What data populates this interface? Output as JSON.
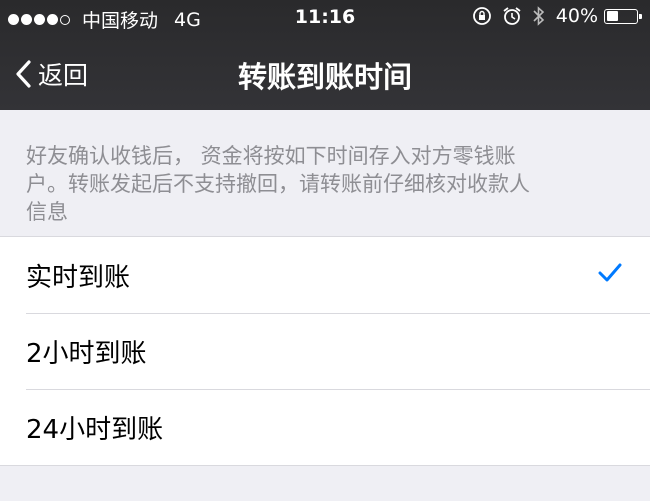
{
  "status_bar": {
    "carrier": "中国移动",
    "network": "4G",
    "time": "11:16",
    "battery": "40%",
    "battery_level": 0.4
  },
  "nav": {
    "back_label": "返回",
    "title": "转账到账时间"
  },
  "notice": {
    "lines": [
      "好友确认收钱后， 资金将按如下时间存入对方零钱账",
      "户。转账发起后不支持撤回，请转账前仔细核对收款人",
      "信息"
    ]
  },
  "options": [
    {
      "label": "实时到账",
      "selected": true
    },
    {
      "label": "2小时到账",
      "selected": false
    },
    {
      "label": "24小时到账",
      "selected": false
    }
  ],
  "colors": {
    "accent": "#007aff",
    "nav_bg": "#2f2f31",
    "page_bg": "#efeff4",
    "muted_text": "#8e8e93"
  }
}
